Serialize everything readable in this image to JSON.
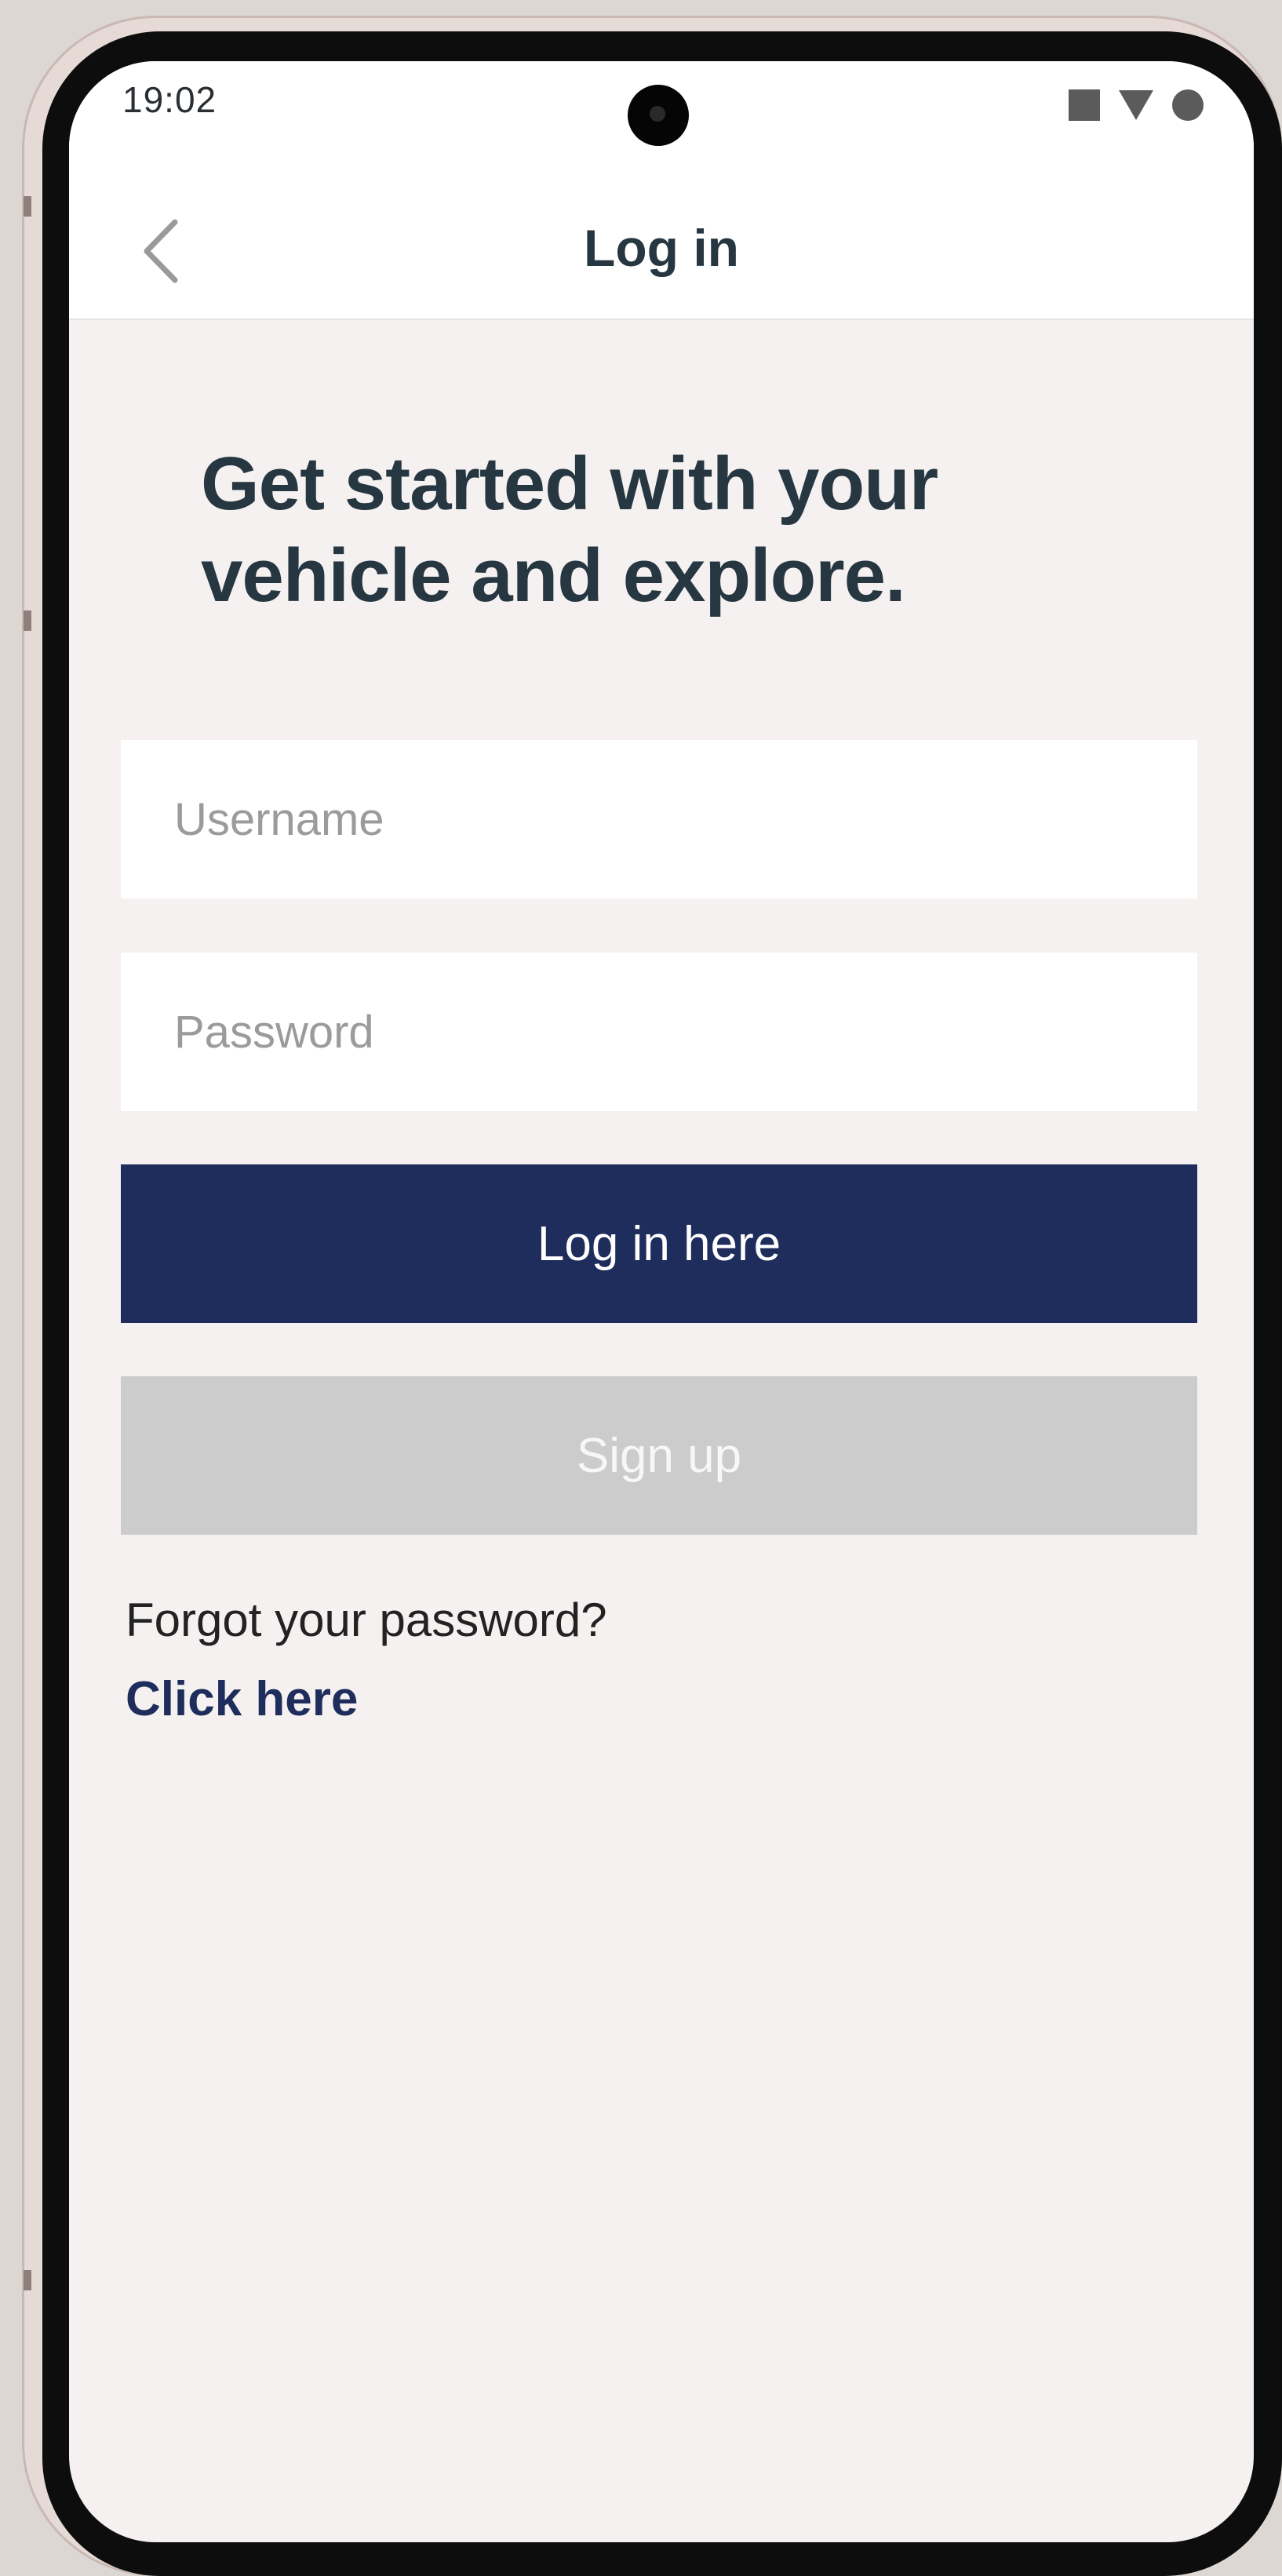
{
  "status_bar": {
    "time": "19:02",
    "icons": [
      "stop-square-icon",
      "wifi-triangle-icon",
      "battery-dot-icon"
    ]
  },
  "header": {
    "title": "Log in",
    "back_icon": "chevron-left-icon"
  },
  "main": {
    "headline": "Get started with your vehicle and explore.",
    "username_placeholder": "Username",
    "password_placeholder": "Password",
    "login_button": "Log in here",
    "signup_button": "Sign up",
    "forgot_text": "Forgot your password?",
    "forgot_link": "Click here"
  },
  "colors": {
    "primary": "#1f2d5c",
    "disabled": "#cccccc",
    "background": "#f4f1f0",
    "text_dark": "#273742"
  }
}
